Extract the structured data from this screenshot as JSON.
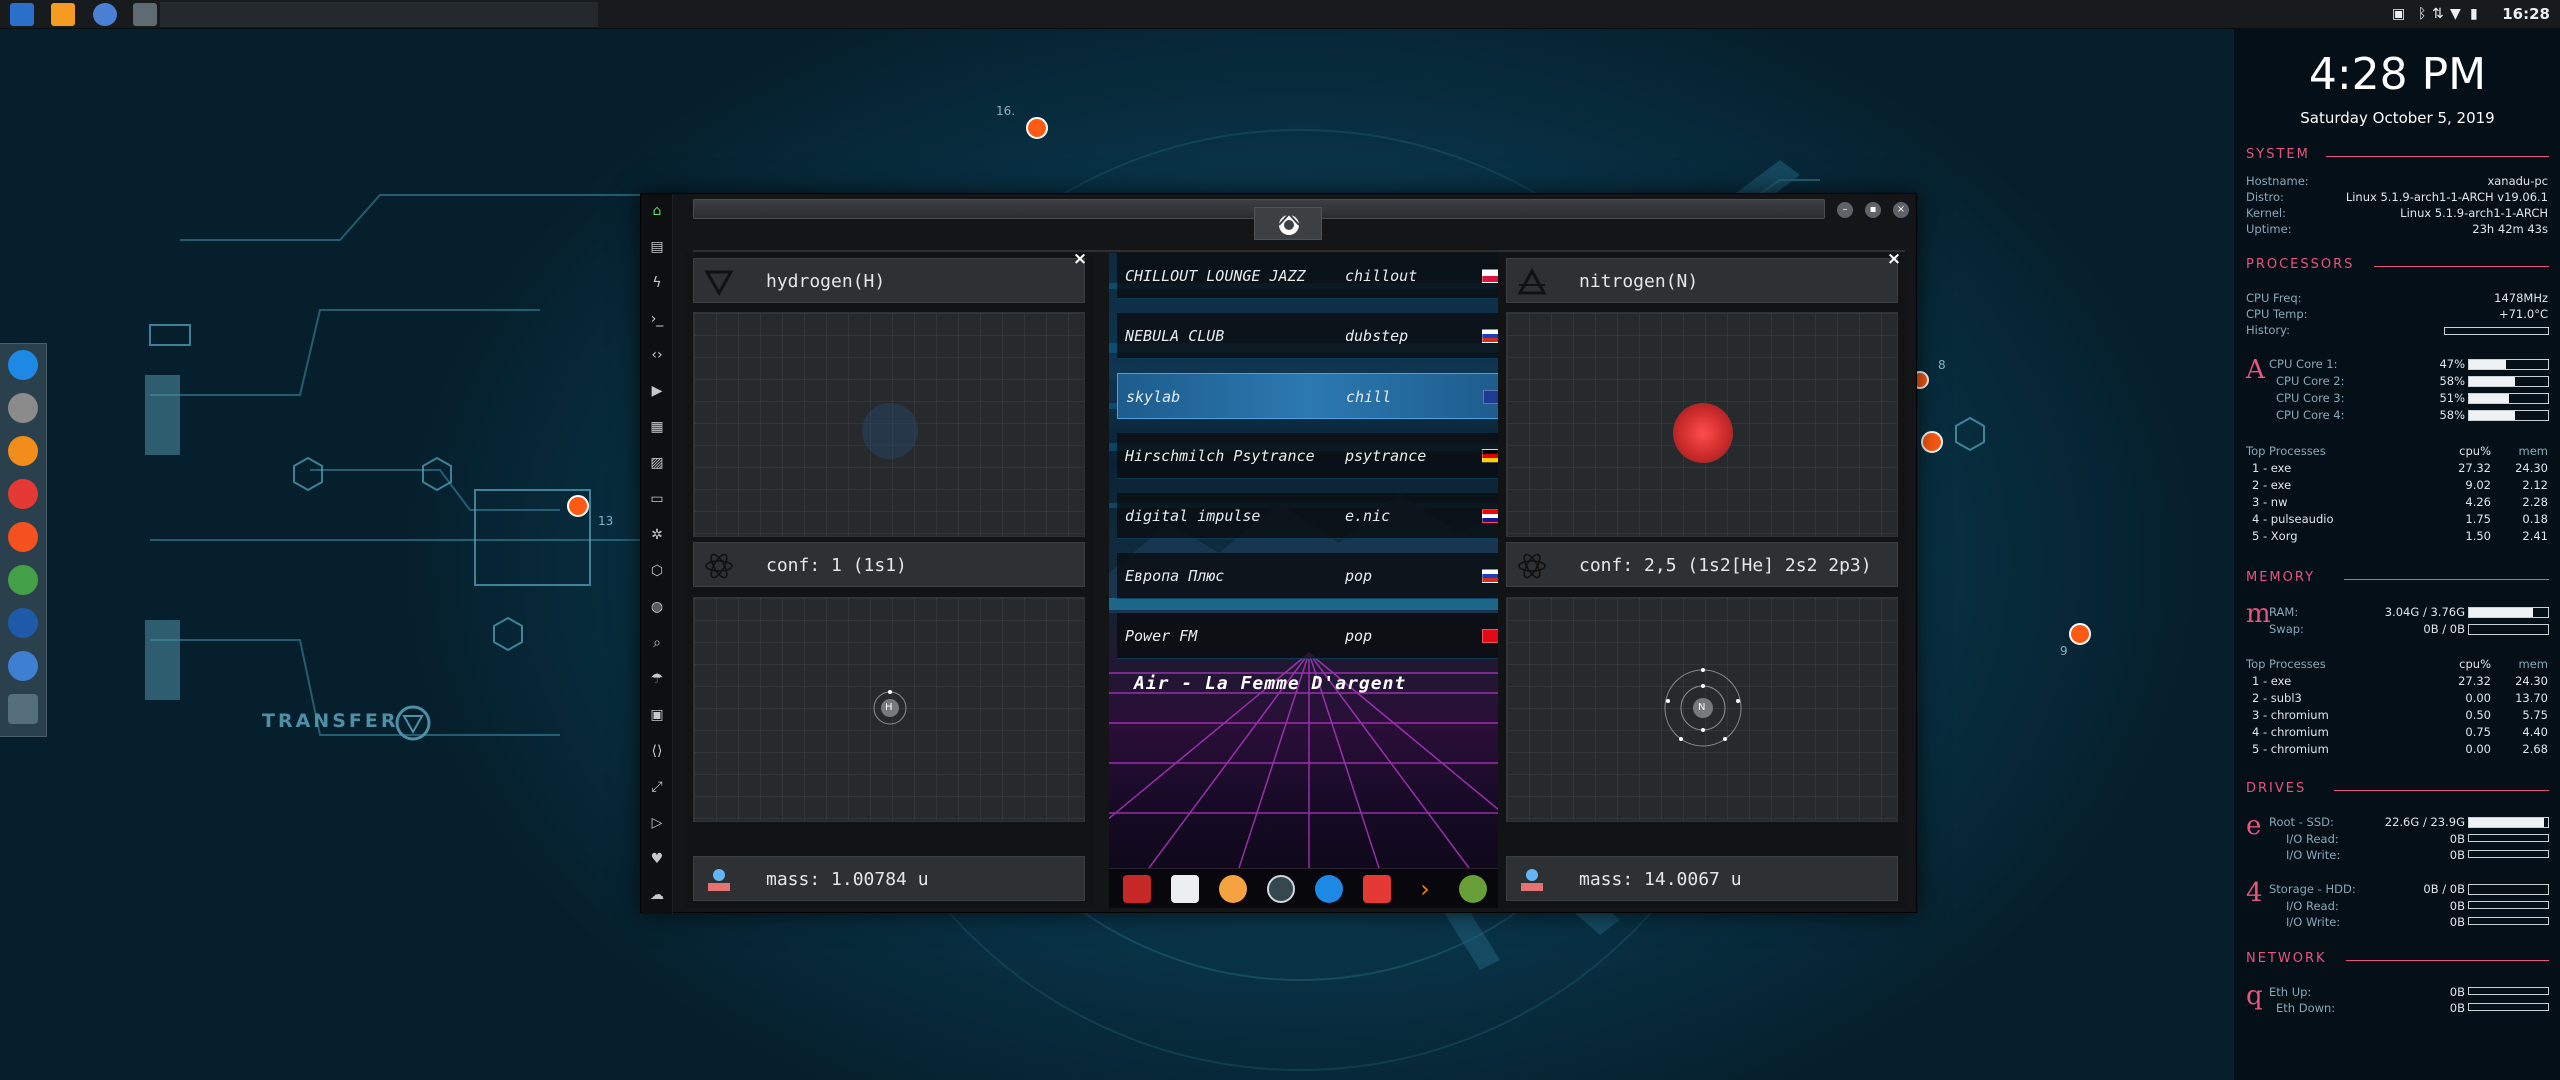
{
  "taskbar": {
    "clock": "16:28",
    "apps": [
      "file-manager-icon",
      "sublime-icon",
      "chrome-icon",
      "window-icon"
    ],
    "tray": [
      "image-icon",
      "bluetooth-icon",
      "wifi-icon",
      "battery-icon"
    ]
  },
  "desktop": {
    "transfer_label": "TRANSFER",
    "markers": [
      "16.",
      "13",
      "8",
      "9"
    ]
  },
  "dock": {
    "items": [
      "files",
      "money",
      "ubuntu",
      "vivaldi",
      "scribus",
      "activity",
      "screenshot",
      "chrome-remote",
      "grid"
    ]
  },
  "window": {
    "sidebar": [
      "home",
      "document",
      "bolt",
      "terminal",
      "code",
      "play",
      "photo",
      "image",
      "news",
      "settings",
      "hexagon",
      "globe",
      "search",
      "umbrella",
      "contacts",
      "code-alt",
      "expand",
      "youtube",
      "heart",
      "cloud"
    ],
    "left_panel": {
      "element": "hydrogen(H)",
      "conf": "conf: 1 (1s1)",
      "mass": "mass: 1.00784 u",
      "atom_symbol": "H"
    },
    "right_panel": {
      "element": "nitrogen(N)",
      "conf": "conf: 2,5 (1s2[He] 2s2 2p3)",
      "mass": "mass: 14.0067 u",
      "atom_symbol": "N"
    },
    "radio": {
      "stations": [
        {
          "name": "CHILLOUT LOUNGE JAZZ",
          "genre": "chillout",
          "flag": "poland"
        },
        {
          "name": "NEBULA CLUB",
          "genre": "dubstep",
          "flag": "russia"
        },
        {
          "name": "skylab",
          "genre": "chill",
          "flag": "uk"
        },
        {
          "name": "Hirschmilch Psytrance",
          "genre": "psytrance",
          "flag": "germany"
        },
        {
          "name": "digital impulse",
          "genre": "e.nic",
          "flag": "croatia"
        },
        {
          "name": "Европа Плюс",
          "genre": "pop",
          "flag": "russia"
        },
        {
          "name": "Power FM",
          "genre": "pop",
          "flag": "turkey"
        }
      ],
      "now_playing": "Air - La Femme D'argent",
      "dock": [
        "red-app",
        "calendar-app",
        "search-app",
        "clock-app",
        "globe-app",
        "calendar2-app",
        "arrow-app",
        "yandex-app"
      ]
    }
  },
  "conky": {
    "time": "4:28 PM",
    "date": "Saturday October  5, 2019",
    "system": {
      "title": "SYSTEM",
      "rows": [
        {
          "label": "Hostname:",
          "value": "xanadu-pc"
        },
        {
          "label": "Distro:",
          "value": "Linux 5.1.9-arch1-1-ARCH v19.06.1"
        },
        {
          "label": "Kernel:",
          "value": "Linux 5.1.9-arch1-1-ARCH"
        },
        {
          "label": "Uptime:",
          "value": "23h 42m 43s"
        }
      ]
    },
    "processors": {
      "title": "PROCESSORS",
      "freq_label": "CPU Freq:",
      "freq": "1478MHz",
      "temp_label": "CPU Temp:",
      "temp": "+71.0°C",
      "history_label": "History:",
      "glyph": "A",
      "cores": [
        {
          "label": "CPU Core 1:",
          "value": "47%",
          "pct": 47
        },
        {
          "label": "CPU Core 2:",
          "value": "58%",
          "pct": 58
        },
        {
          "label": "CPU Core 3:",
          "value": "51%",
          "pct": 51
        },
        {
          "label": "CPU Core 4:",
          "value": "58%",
          "pct": 58
        }
      ],
      "top_title": "Top Processes",
      "col_cpu": "cpu%",
      "col_mem": "mem",
      "procs": [
        {
          "name": "1 - exe",
          "cpu": "27.32",
          "mem": "24.30"
        },
        {
          "name": "2 - exe",
          "cpu": "9.02",
          "mem": "2.12"
        },
        {
          "name": "3 - nw",
          "cpu": "4.26",
          "mem": "2.28"
        },
        {
          "name": "4 - pulseaudio",
          "cpu": "1.75",
          "mem": "0.18"
        },
        {
          "name": "5 - Xorg",
          "cpu": "1.50",
          "mem": "2.41"
        }
      ]
    },
    "memory": {
      "title": "MEMORY",
      "glyph": "m",
      "ram_label": "RAM:",
      "ram": "3.04G / 3.76G",
      "ram_pct": 81,
      "swap_label": "Swap:",
      "swap": "0B / 0B",
      "swap_pct": 0,
      "top_title": "Top Processes",
      "col_cpu": "cpu%",
      "col_mem": "mem",
      "procs": [
        {
          "name": "1 - exe",
          "cpu": "27.32",
          "mem": "24.30"
        },
        {
          "name": "2 - subl3",
          "cpu": "0.00",
          "mem": "13.70"
        },
        {
          "name": "3 - chromium",
          "cpu": "0.50",
          "mem": "5.75"
        },
        {
          "name": "4 - chromium",
          "cpu": "0.75",
          "mem": "4.40"
        },
        {
          "name": "5 - chromium",
          "cpu": "0.00",
          "mem": "2.68"
        }
      ]
    },
    "drives": {
      "title": "DRIVES",
      "root_glyph": "e",
      "root_label": "Root  - SSD:",
      "root": "22.6G / 23.9G",
      "root_pct": 95,
      "root_read_label": "I/O Read:",
      "root_read": "0B",
      "root_write_label": "I/O Write:",
      "root_write": "0B",
      "storage_glyph": "4",
      "storage_label": "Storage  - HDD:",
      "storage": "0B / 0B",
      "storage_pct": 0,
      "storage_read_label": "I/O Read:",
      "storage_read": "0B",
      "storage_write_label": "I/O Write:",
      "storage_write": "0B"
    },
    "network": {
      "title": "NETWORK",
      "glyph": "q",
      "up_label": "Eth Up:",
      "up": "0B",
      "down_label": "Eth Down:",
      "down": "0B"
    }
  },
  "colors": {
    "accent": "#e8557f",
    "orange_node": "#ff5a14",
    "selected_station": "#2c79b0"
  }
}
